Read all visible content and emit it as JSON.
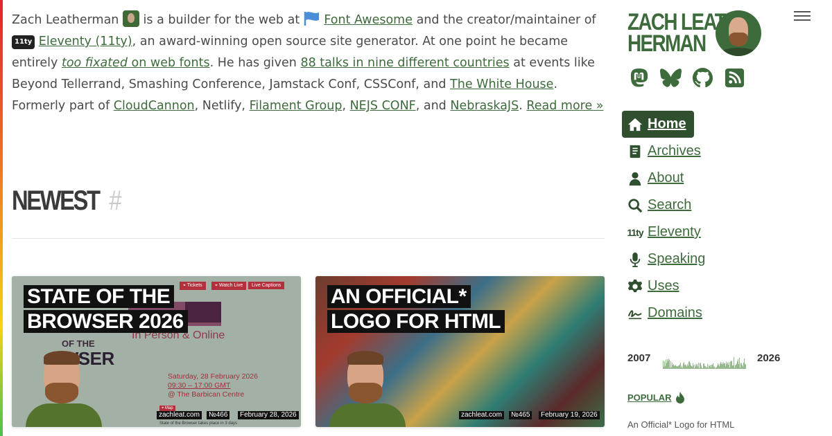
{
  "intro": {
    "name": "Zach Leatherman",
    "t1": "is a builder for the web at",
    "font_awesome": "Font Awesome",
    "t2": "and the creator/maintainer of",
    "eleventy_badge": "11ty",
    "eleventy_link": "Eleventy (11ty)",
    "t3": ", an award-winning open source site generator. At one point he became entirely",
    "too_fixated": "too fixated",
    "on_web_fonts": "on web fonts",
    "t4": ". He has given",
    "talks_link": "88 talks in nine different countries",
    "t5": "at events like Beyond Tellerrand, Smashing Conference, Jamstack Conf, CSSConf, and",
    "white_house": "The White House",
    "t6": ". Formerly part of",
    "cloudcannon": "CloudCannon",
    "t7": ", Netlify,",
    "filament": "Filament Group",
    "sep1": ",",
    "nejs": "NEJS CONF",
    "t8": ", and",
    "nebraskajs": "NebraskaJS",
    "t9": ".",
    "read_more": "Read more »"
  },
  "newest": {
    "title": "NEWEST",
    "hash": "#"
  },
  "cards": [
    {
      "title_l1": "STATE OF THE",
      "title_l2": "BROWSER 2026",
      "site": "zachleat.com",
      "number": "№466",
      "date": "February 28, 2026",
      "caption": "State of the Browser takes place in 3 days",
      "poster": {
        "btn_tickets": "⌖ Tickets",
        "btn_watch": "⌖ Watch Live",
        "btn_captions": "Live Captions",
        "in_person": "In Person & Online",
        "of_the": "OF THE",
        "owser": "OWSER",
        "date_l1": "Saturday, 28 February 2026",
        "date_l2": "09:30 – 17:00 GMT",
        "date_l3": "@ The Barbican Centre",
        "map": "⌖ Map"
      }
    },
    {
      "title_l1": "AN OFFICIAL*",
      "title_l2": "LOGO FOR HTML",
      "site": "zachleat.com",
      "number": "№465",
      "date": "February 19, 2026"
    }
  ],
  "sidebar": {
    "brand_l1": "ZACH LEAT-",
    "brand_l2": "HERMAN",
    "socials": [
      "mastodon-icon",
      "bluesky-icon",
      "github-icon",
      "rss-icon"
    ],
    "nav": [
      {
        "label": "Home",
        "icon": "home-icon",
        "active": true
      },
      {
        "label": "Archives",
        "icon": "book-icon"
      },
      {
        "label": "About",
        "icon": "person-icon"
      },
      {
        "label": "Search",
        "icon": "search-icon"
      },
      {
        "label": "Eleventy",
        "icon": "eleventy-icon"
      },
      {
        "label": "Speaking",
        "icon": "microphone-icon"
      },
      {
        "label": "Uses",
        "icon": "gear-icon"
      },
      {
        "label": "Domains",
        "icon": "signature-icon"
      }
    ],
    "eleventy_glyph": "11ty",
    "spark_start": "2007",
    "spark_end": "2026",
    "popular_label": "POPULAR",
    "popular_first": "An Official* Logo for HTML"
  },
  "colors": {
    "accent": "#3e6b3c",
    "nav_active_bg": "#2f4f2e",
    "text": "#4a4a4a"
  }
}
